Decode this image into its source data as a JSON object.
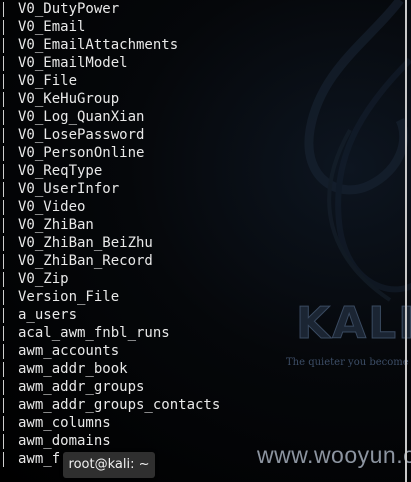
{
  "terminal": {
    "lines": [
      "V0_DutyPower",
      "V0_Email",
      "V0_EmailAttachments",
      "V0_EmailModel",
      "V0_File",
      "V0_KeHuGroup",
      "V0_Log_QuanXian",
      "V0_LosePassword",
      "V0_PersonOnline",
      "V0_ReqType",
      "V0_UserInfor",
      "V0_Video",
      "V0_ZhiBan",
      "V0_ZhiBan_BeiZhu",
      "V0_ZhiBan_Record",
      "V0_Zip",
      "Version_File",
      "a_users",
      "acal_awm_fnbl_runs",
      "awm_accounts",
      "awm_addr_book",
      "awm_addr_groups",
      "awm_addr_groups_contacts",
      "awm_columns",
      "awm_domains",
      "awm_f"
    ]
  },
  "wallpaper": {
    "brand": "KALI",
    "tagline": "The quieter you become",
    "watermark": "www.wooyun.org"
  },
  "tooltip": {
    "label": "root@kali: ~"
  },
  "colors": {
    "terminal_bg": "#000000",
    "text": "#e9e9e9",
    "tooltip_bg": "#2f2f2f"
  }
}
